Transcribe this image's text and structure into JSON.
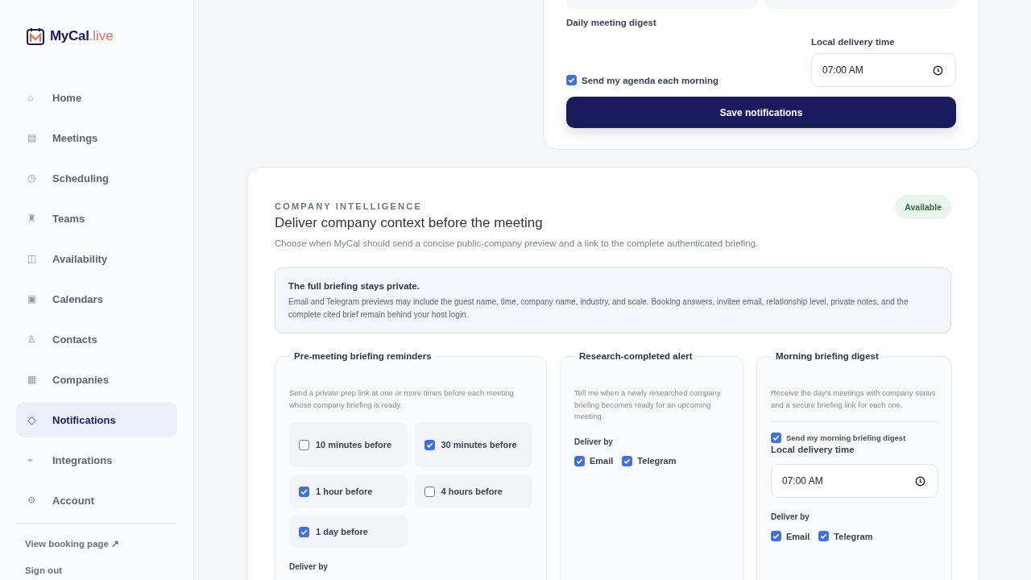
{
  "sidebar": {
    "logo": {
      "name": "MyCal",
      "suffix": ".live"
    },
    "items": [
      {
        "icon": "⌂",
        "label": "Home",
        "selected": false
      },
      {
        "icon": "▤",
        "label": "Meetings",
        "selected": false
      },
      {
        "icon": "◷",
        "label": "Scheduling",
        "selected": false
      },
      {
        "icon": "♜",
        "label": "Teams",
        "selected": false
      },
      {
        "icon": "◫",
        "label": "Availability",
        "selected": false
      },
      {
        "icon": "▣",
        "label": "Calendars",
        "selected": false
      },
      {
        "icon": "♙",
        "label": "Contacts",
        "selected": false
      },
      {
        "icon": "▦",
        "label": "Companies",
        "selected": false
      },
      {
        "icon": "◇",
        "label": "Notifications",
        "selected": true
      },
      {
        "icon": "⌁",
        "label": "Integrations",
        "selected": false
      },
      {
        "icon": "⚙",
        "label": "Account",
        "selected": false
      }
    ],
    "footer_links": [
      {
        "label": "View booking page ↗"
      },
      {
        "label": "Sign out"
      }
    ]
  },
  "notifications_card": {
    "digest_title": "Daily meeting digest",
    "agenda_checkbox": {
      "label": "Send my agenda each morning",
      "checked": true
    },
    "time_label": "Local delivery time",
    "time_value": "07:00 AM",
    "save_button": "Save notifications"
  },
  "company_intelligence": {
    "eyebrow": "COMPANY INTELLIGENCE",
    "title": "Deliver company context before the meeting",
    "subtitle": "Choose when MyCal should send a concise public-company preview and a link to the complete authenticated briefing.",
    "badge": "Available",
    "notice": {
      "title": "The full briefing stays private.",
      "body": "Email and Telegram previews may include the guest name, time, company name, industry, and scale. Booking answers, invitee email, relationship level, private notes, and the complete cited brief remain behind your host login."
    },
    "sections": [
      {
        "kind": "reminders",
        "title": "Pre-meeting briefing reminders",
        "description": "Send a private prep link at one or more times before each meeting whose company briefing is ready.",
        "options": [
          {
            "label": "10 minutes before",
            "checked": false
          },
          {
            "label": "30 minutes before",
            "checked": true
          },
          {
            "label": "1 hour before",
            "checked": true
          },
          {
            "label": "4 hours before",
            "checked": false
          },
          {
            "label": "1 day before",
            "checked": true
          }
        ],
        "deliver_label": "Deliver by"
      },
      {
        "kind": "alert",
        "title": "Research-completed alert",
        "description": "Tell me when a newly researched company briefing becomes ready for an upcoming meeting.",
        "deliver_label": "Deliver by",
        "channels": [
          {
            "label": "Email",
            "checked": true
          },
          {
            "label": "Telegram",
            "checked": true
          }
        ]
      },
      {
        "kind": "digest",
        "title": "Morning briefing digest",
        "description": "Receive the day's meetings with company status and a secure briefing link for each one.",
        "digest_checkbox": {
          "label": "Send my morning briefing digest",
          "checked": true
        },
        "time_label": "Local delivery time",
        "time_value": "07:00 AM",
        "deliver_label": "Deliver by",
        "channels": [
          {
            "label": "Email",
            "checked": true
          },
          {
            "label": "Telegram",
            "checked": true
          }
        ]
      }
    ]
  }
}
